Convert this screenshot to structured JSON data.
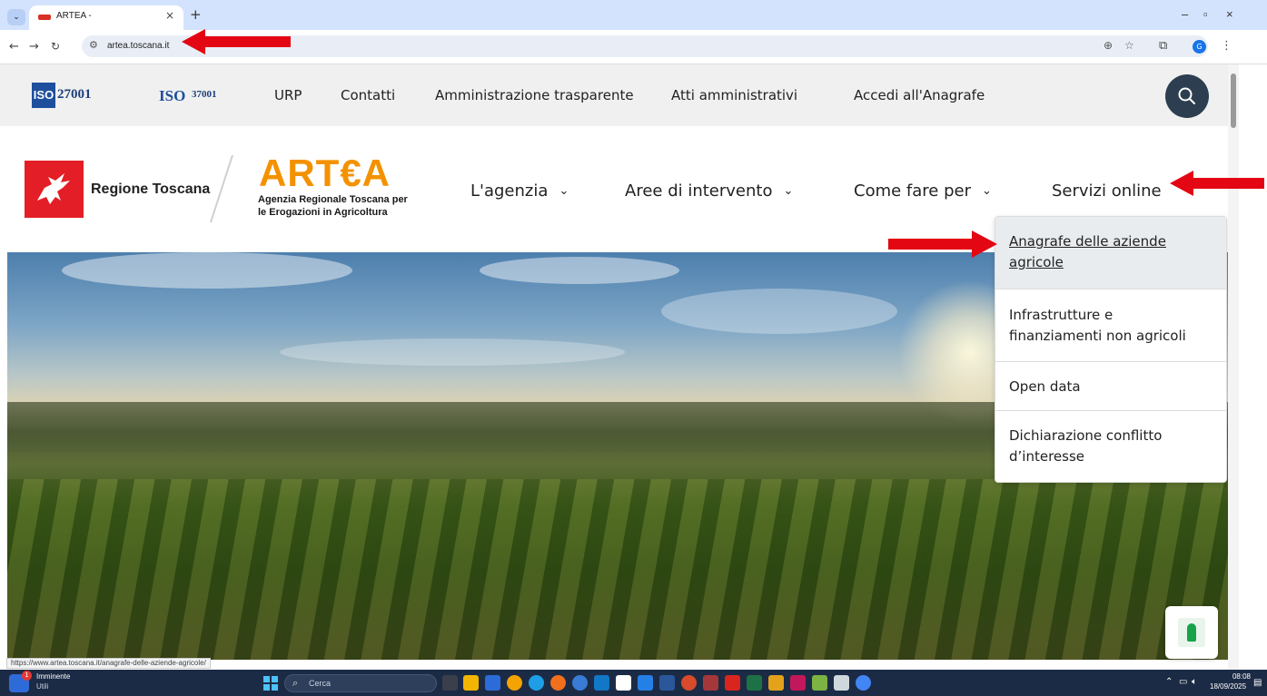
{
  "browser": {
    "tab_title": "ARTEA -",
    "tab_close": "×",
    "new_tab": "+",
    "url": "artea.toscana.it",
    "minimize": "–",
    "restore": "▫",
    "close": "×",
    "profile_initial": "G"
  },
  "topbar": {
    "iso1_box": "ISO",
    "iso1_num": "27001",
    "iso2_box": "ISO",
    "iso2_num": "37001",
    "links": [
      "URP",
      "Contatti",
      "Amministrazione trasparente",
      "Atti amministrativi",
      "Accedi all'Anagrafe"
    ]
  },
  "header": {
    "regione": "Regione Toscana",
    "artea_logo": "ART€A",
    "artea_sub_line1": "Agenzia Regionale Toscana per",
    "artea_sub_line2": "le Erogazioni in Agricoltura",
    "nav": [
      {
        "label": "L'agenzia",
        "chevron": "⌄"
      },
      {
        "label": "Aree di intervento",
        "chevron": "⌄"
      },
      {
        "label": "Come fare per",
        "chevron": "⌄"
      },
      {
        "label": "Servizi online",
        "chevron": ""
      }
    ]
  },
  "dropdown": {
    "items": [
      {
        "line1": "Anagrafe delle aziende",
        "line2": "agricole"
      },
      {
        "line1": "Infrastrutture e",
        "line2": "finanziamenti non agricoli"
      },
      {
        "line1": "Open data",
        "line2": ""
      },
      {
        "line1": "Dichiarazione conflitto",
        "line2": "d’interesse"
      }
    ]
  },
  "status_url": "https://www.artea.toscana.it/anagrafe-delle-aziende-agricole/",
  "taskbar": {
    "weather_badge": "1",
    "weather_title": "Imminente",
    "weather_sub": "Utili",
    "search_placeholder": "Cerca",
    "clock_time": "08:08",
    "clock_date": "18/09/2025"
  },
  "colors": {
    "artea_orange": "#f39200",
    "regione_red": "#e41e26",
    "arrow_red": "#e30613",
    "search_btn": "#2c3e50",
    "taskbar": "#1c2b45"
  }
}
